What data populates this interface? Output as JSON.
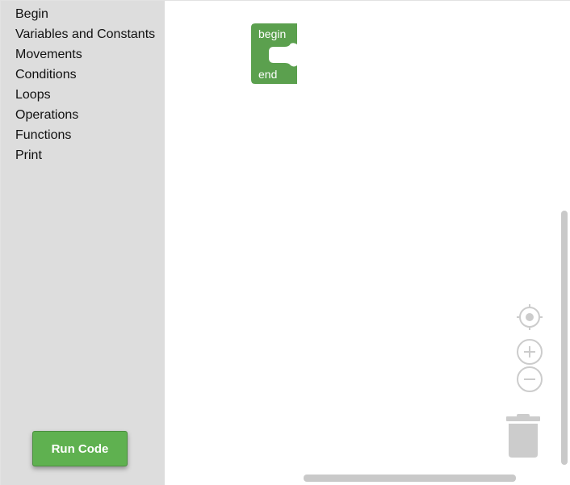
{
  "toolbox": {
    "categories": [
      "Begin",
      "Variables and Constants",
      "Movements",
      "Conditions",
      "Loops",
      "Operations",
      "Functions",
      "Print"
    ],
    "run_button_label": "Run Code"
  },
  "workspace": {
    "block": {
      "top_label": "begin",
      "bottom_label": "end",
      "color": "#5ba04e"
    },
    "controls": {
      "recenter_icon": "crosshair-icon",
      "zoom_in_icon": "plus-circle-icon",
      "zoom_out_icon": "minus-circle-icon",
      "trash_icon": "trash-can-icon"
    }
  },
  "colors": {
    "toolbox_background": "#dddddd",
    "run_button": "#5fb150",
    "scrollbar": "#c9c9c9",
    "control_gray": "#cccccc"
  }
}
